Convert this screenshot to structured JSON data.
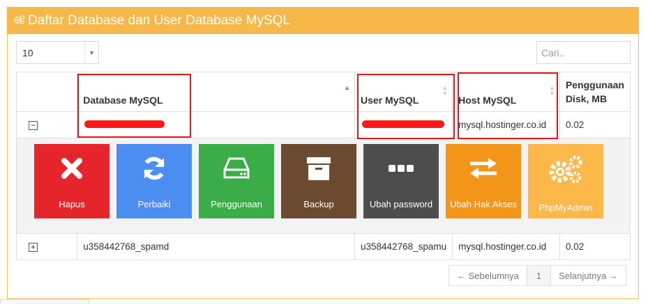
{
  "panel": {
    "title": "Daftar Database dan User Database MySQL",
    "icon": "gears-icon"
  },
  "controls": {
    "page_size": "10",
    "search_placeholder": "Cari.."
  },
  "table": {
    "columns": [
      "Database MySQL",
      "User MySQL",
      "Host MySQL",
      "Penggunaan Disk, MB"
    ],
    "rows": [
      {
        "toggle": "−",
        "database": "",
        "user": "",
        "host": "mysql.hostinger.co.id",
        "disk": "0.02",
        "expanded": true
      },
      {
        "toggle": "+",
        "database": "u358442768_spamd",
        "user": "u358442768_spamu",
        "host": "mysql.hostinger.co.id",
        "disk": "0.02",
        "expanded": false
      }
    ]
  },
  "actions": [
    {
      "label": "Hapus",
      "color": "#e5252b",
      "icon": "close-icon"
    },
    {
      "label": "Perbaiki",
      "color": "#4c8df2",
      "icon": "refresh-icon"
    },
    {
      "label": "Penggunaan",
      "color": "#3aad48",
      "icon": "hard-drive-icon"
    },
    {
      "label": "Backup",
      "color": "#6b4a2f",
      "icon": "archive-box-icon"
    },
    {
      "label": "Ubah password",
      "color": "#4d4d4d",
      "icon": "dots-icon"
    },
    {
      "label": "Ubah Hak Akses",
      "color": "#f29518",
      "icon": "swap-arrows-icon"
    },
    {
      "label": "PhpMyAdmin",
      "color": "#fcb94a",
      "icon": "gears-icon"
    }
  ],
  "pagination": {
    "prev": "← Sebelumnya",
    "page": "1",
    "next": "Selanjutnya →"
  }
}
